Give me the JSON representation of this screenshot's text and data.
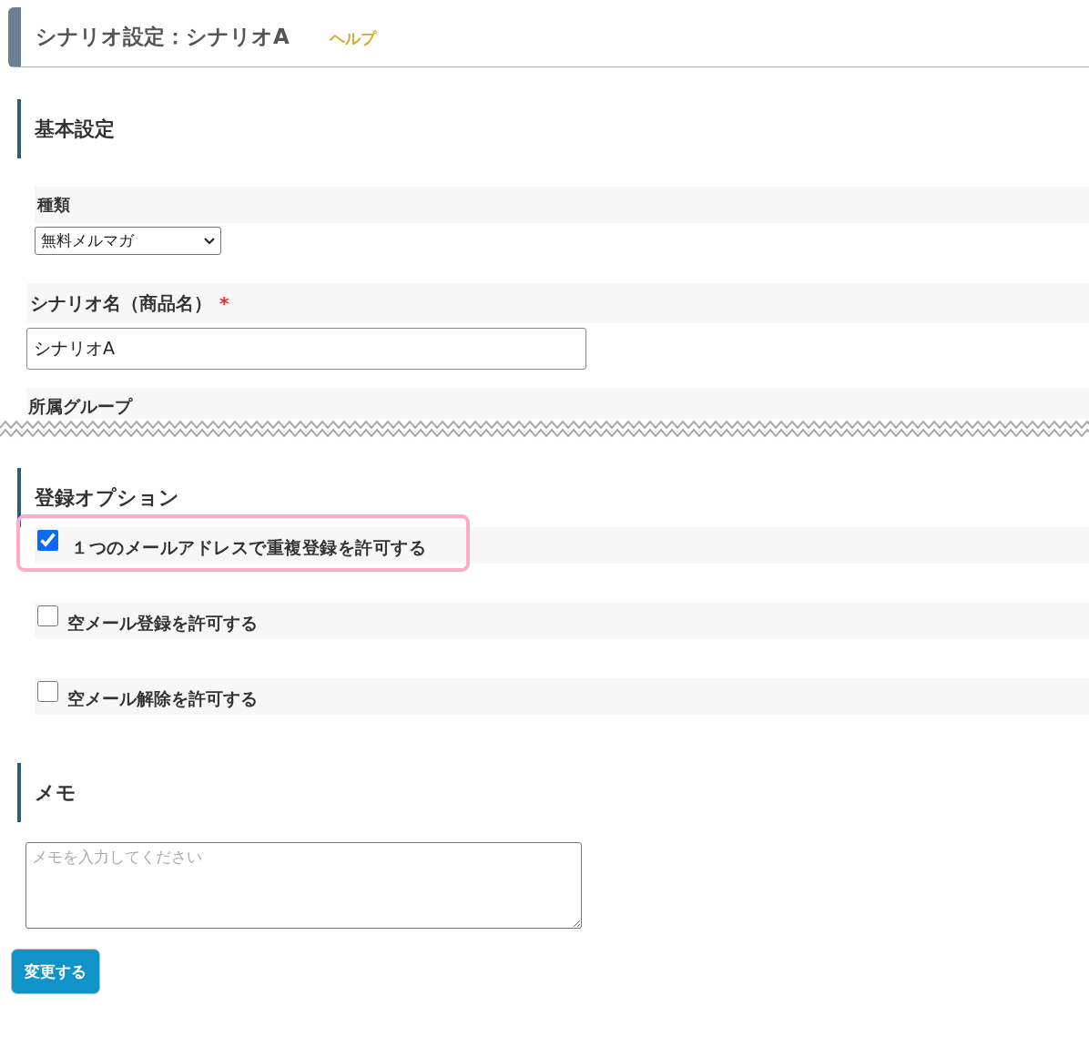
{
  "header": {
    "title": "シナリオ設定：シナリオA",
    "help_link": "ヘルプ"
  },
  "basic_settings": {
    "heading": "基本設定",
    "type_field": {
      "label": "種類",
      "value": "無料メルマガ"
    },
    "name_field": {
      "label": "シナリオ名（商品名）",
      "required_mark": "*",
      "value": "シナリオA"
    },
    "group_field": {
      "label": "所属グループ"
    }
  },
  "registration_options": {
    "heading": "登録オプション",
    "options": [
      {
        "label": "１つのメールアドレスで重複登録を許可する",
        "checked": true,
        "highlighted": true
      },
      {
        "label": "空メール登録を許可する",
        "checked": false,
        "highlighted": false
      },
      {
        "label": "空メール解除を許可する",
        "checked": false,
        "highlighted": false
      }
    ]
  },
  "memo": {
    "heading": "メモ",
    "placeholder": "メモを入力してください"
  },
  "submit_button": "変更する"
}
